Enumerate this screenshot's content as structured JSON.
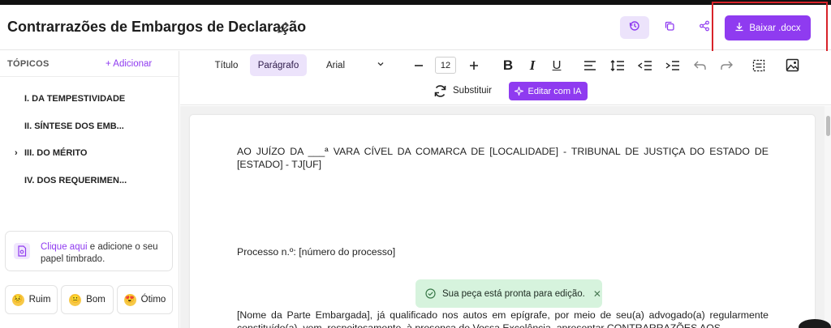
{
  "header": {
    "title": "Contrarrazões de Embargos de Declaração",
    "download_label": "Baixar .docx",
    "icons": [
      "pencil-icon",
      "history-icon",
      "copy-icon",
      "share-icon",
      "download-icon"
    ],
    "accent_color": "#8f3bf0",
    "highlight_color": "#d8232a"
  },
  "sidebar": {
    "title": "TÓPICOS",
    "add_label": "+ Adicionar",
    "topics": [
      {
        "label": "I. DA TEMPESTIVIDADE",
        "expandable": false
      },
      {
        "label": "II. SÍNTESE DOS EMB...",
        "expandable": false
      },
      {
        "label": "III. DO MÉRITO",
        "expandable": true
      },
      {
        "label": "IV. DOS REQUERIMEN...",
        "expandable": false
      }
    ],
    "letterhead": {
      "link_text": "Clique aqui",
      "text": " e adicione o seu papel timbrado."
    },
    "ratings": [
      {
        "label": "Ruim",
        "emoji": "😣"
      },
      {
        "label": "Bom",
        "emoji": "😐"
      },
      {
        "label": "Ótimo",
        "emoji": "😍"
      }
    ]
  },
  "toolbar": {
    "style_titulo": "Título",
    "style_paragrafo": "Parágrafo",
    "font": "Arial",
    "font_size": "12",
    "substituir_label": "Substituir",
    "ia_label": "Editar com IA"
  },
  "document": {
    "paragraph_1": "AO JUÍZO DA ___ª VARA CÍVEL DA COMARCA DE [LOCALIDADE] - TRIBUNAL DE JUSTIÇA DO ESTADO DE [ESTADO] - TJ[UF]",
    "paragraph_2": "Processo n.º: [número do processo]",
    "paragraph_3": "[Nome da Parte Embargada], já qualificado nos autos em epígrafe, por meio de seu(a) advogado(a) regularmente constituído(a), vem, respeitosamente, à presença de Vossa Excelência, apresentar CONTRARRAZÕES AOS"
  },
  "toast": {
    "message": "Sua peça está pronta para edição."
  }
}
